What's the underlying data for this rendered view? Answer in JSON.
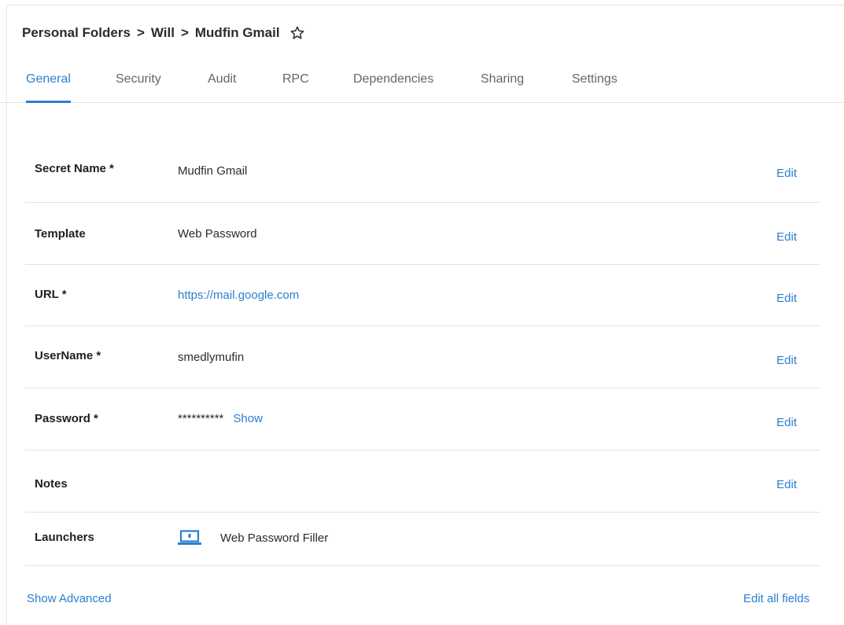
{
  "breadcrumb": {
    "items": [
      "Personal Folders",
      "Will",
      "Mudfin Gmail"
    ],
    "separator": ">"
  },
  "favorite_icon": "star-outline-icon",
  "tabs": [
    {
      "label": "General",
      "active": true
    },
    {
      "label": "Security",
      "active": false
    },
    {
      "label": "Audit",
      "active": false
    },
    {
      "label": "RPC",
      "active": false
    },
    {
      "label": "Dependencies",
      "active": false
    },
    {
      "label": "Sharing",
      "active": false
    },
    {
      "label": "Settings",
      "active": false
    }
  ],
  "fields": {
    "secret_name": {
      "label": "Secret Name *",
      "value": "Mudfin Gmail",
      "edit": "Edit"
    },
    "template": {
      "label": "Template",
      "value": "Web Password",
      "edit": "Edit"
    },
    "url": {
      "label": "URL *",
      "value": "https://mail.google.com",
      "edit": "Edit"
    },
    "username": {
      "label": "UserName *",
      "value": "smedlymufin",
      "edit": "Edit"
    },
    "password": {
      "label": "Password *",
      "mask": "**********",
      "show": "Show",
      "edit": "Edit"
    },
    "notes": {
      "label": "Notes",
      "value": "",
      "edit": "Edit"
    },
    "launchers": {
      "label": "Launchers",
      "icon": "laptop-icon",
      "value": "Web Password Filler"
    }
  },
  "footer": {
    "show_advanced": "Show Advanced",
    "edit_all": "Edit all fields"
  },
  "colors": {
    "accent": "#2a7fcf",
    "divider": "#e3e3e3",
    "text": "#1f1f1f",
    "muted_tab": "#666666"
  }
}
